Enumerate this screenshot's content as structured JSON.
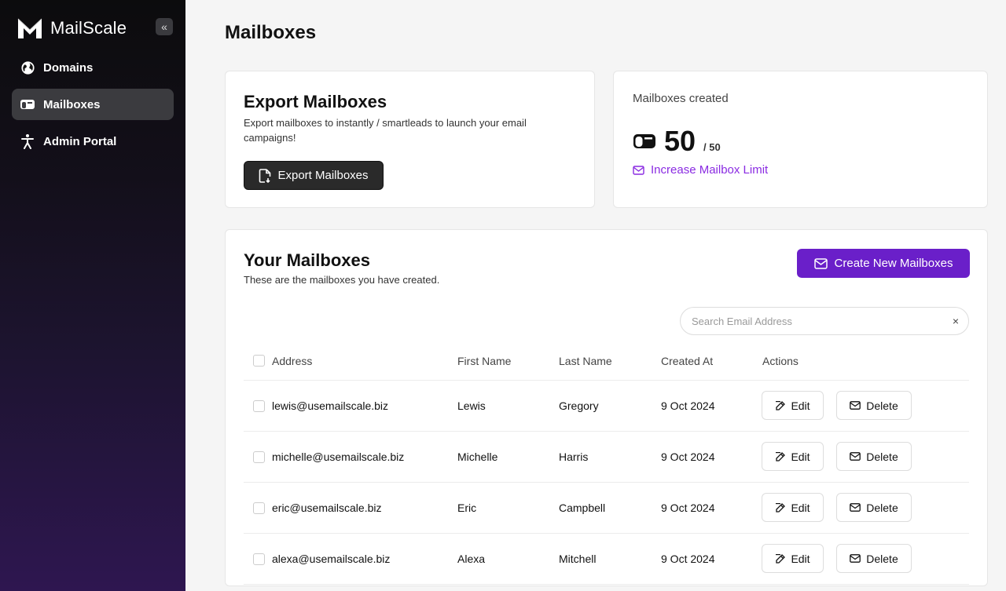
{
  "sidebar": {
    "brand": "MailScale",
    "collapse_icon": "double-chevron-left-icon",
    "items": [
      {
        "label": "Domains",
        "icon": "globe-icon",
        "active": false
      },
      {
        "label": "Mailboxes",
        "icon": "mailbox-icon",
        "active": true
      },
      {
        "label": "Admin Portal",
        "icon": "person-icon",
        "active": false
      }
    ]
  },
  "page": {
    "title": "Mailboxes"
  },
  "export_card": {
    "title": "Export Mailboxes",
    "description": "Export mailboxes to instantly / smartleads to launch your email campaigns!",
    "button_label": "Export Mailboxes"
  },
  "count_card": {
    "label": "Mailboxes created",
    "value": "50",
    "max": "/ 50",
    "link_label": "Increase Mailbox Limit"
  },
  "list": {
    "title": "Your Mailboxes",
    "description": "These are the mailboxes you have created.",
    "create_button": "Create New Mailboxes",
    "search_placeholder": "Search Email Address",
    "search_value": "",
    "clear_symbol": "×",
    "columns": [
      "Address",
      "First Name",
      "Last Name",
      "Created At",
      "Actions"
    ],
    "rows": [
      {
        "address": "lewis@usemailscale.biz",
        "first": "Lewis",
        "last": "Gregory",
        "created": "9 Oct 2024"
      },
      {
        "address": "michelle@usemailscale.biz",
        "first": "Michelle",
        "last": "Harris",
        "created": "9 Oct 2024"
      },
      {
        "address": "eric@usemailscale.biz",
        "first": "Eric",
        "last": "Campbell",
        "created": "9 Oct 2024"
      },
      {
        "address": "alexa@usemailscale.biz",
        "first": "Alexa",
        "last": "Mitchell",
        "created": "9 Oct 2024"
      }
    ],
    "edit_label": "Edit",
    "delete_label": "Delete"
  },
  "colors": {
    "accent": "#6a1fc9",
    "link": "#8a2be2",
    "sidebar_active": "#3b3b3f"
  }
}
